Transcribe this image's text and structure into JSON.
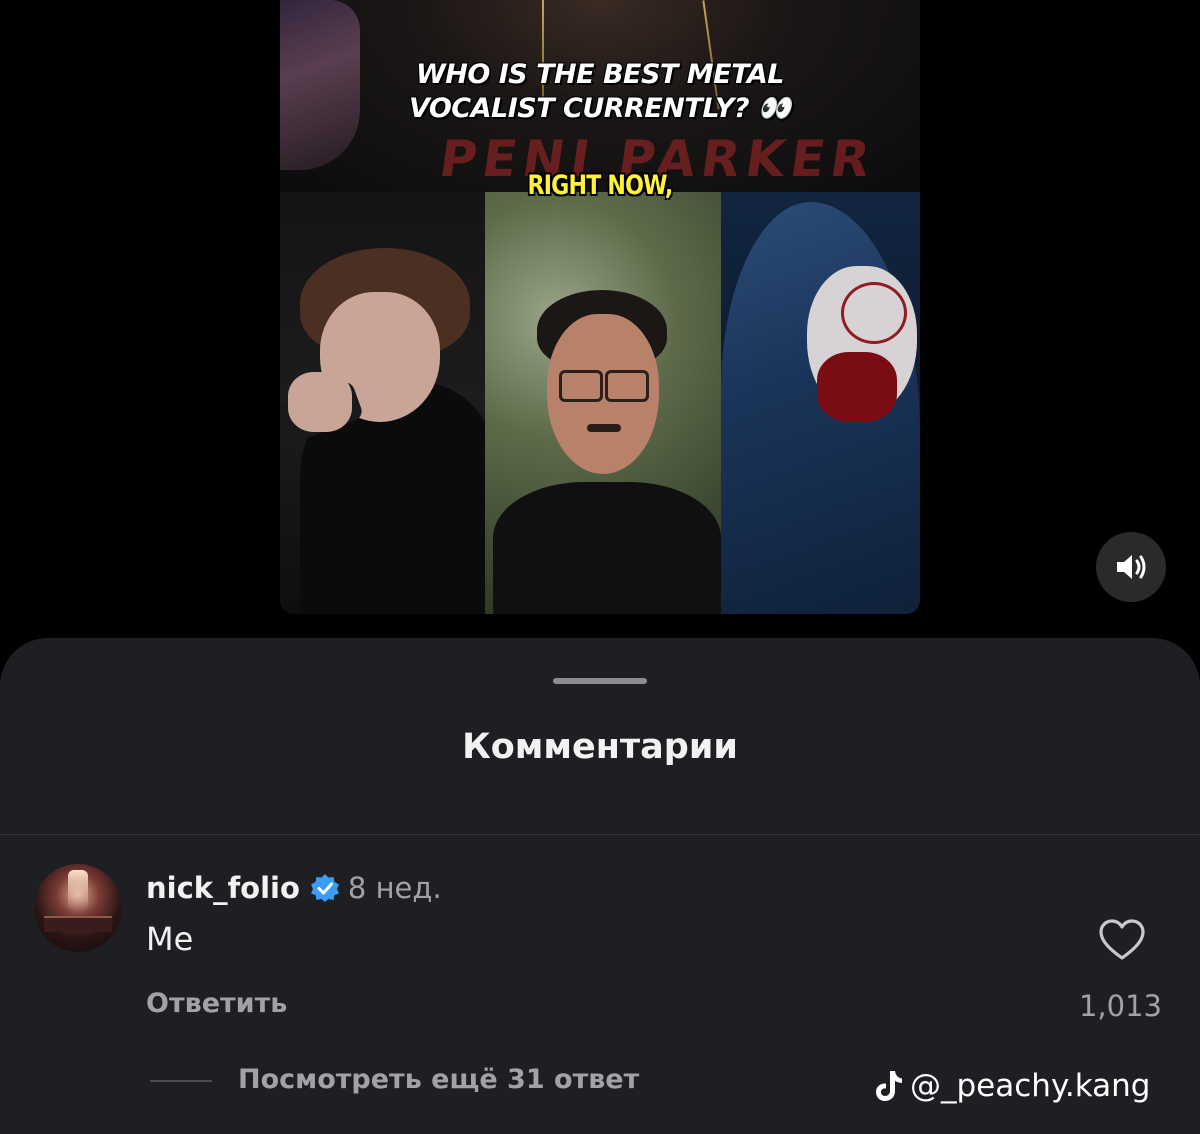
{
  "video": {
    "caption_main_line1": "WHO IS THE BEST METAL",
    "caption_main_line2": "VOCALIST CURRENTLY? 👀",
    "caption_sub": "RIGHT NOW,",
    "shirt_text": "PENI PARKER",
    "sound_icon": "speaker-volume-icon"
  },
  "comments_sheet": {
    "title": "Комментарии",
    "comment": {
      "username": "nick_folio",
      "verified": true,
      "time": "8 нед.",
      "text": "Me",
      "reply_label": "Ответить",
      "like_count": "1,013",
      "view_replies_label": "Посмотреть ещё 31 ответ"
    }
  },
  "watermark": {
    "handle": "@_peachy.kang",
    "icon": "tiktok-icon"
  },
  "colors": {
    "background": "#000000",
    "sheet": "#1e1f22",
    "text_primary": "#f2f2f3",
    "text_secondary": "#a0a2a7",
    "verified_blue": "#3a9cf5",
    "caption_yellow": "#fff23a"
  }
}
